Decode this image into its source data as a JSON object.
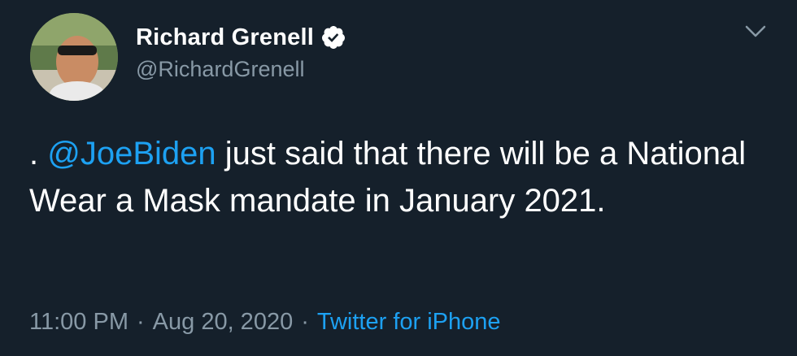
{
  "author": {
    "display_name": "Richard Grenell",
    "handle": "@RichardGrenell",
    "verified": true
  },
  "tweet": {
    "prefix": ". ",
    "mention": "@JoeBiden",
    "text": " just said that there will be a National Wear a Mask mandate in January 2021."
  },
  "meta": {
    "time": "11:00 PM",
    "separator": "·",
    "date": "Aug 20, 2020",
    "source": "Twitter for iPhone"
  },
  "colors": {
    "background": "#15202b",
    "accent": "#1da1f2",
    "muted": "#8899a6"
  },
  "icons": {
    "verified": "verified-badge-icon",
    "caret": "chevron-down-icon"
  }
}
